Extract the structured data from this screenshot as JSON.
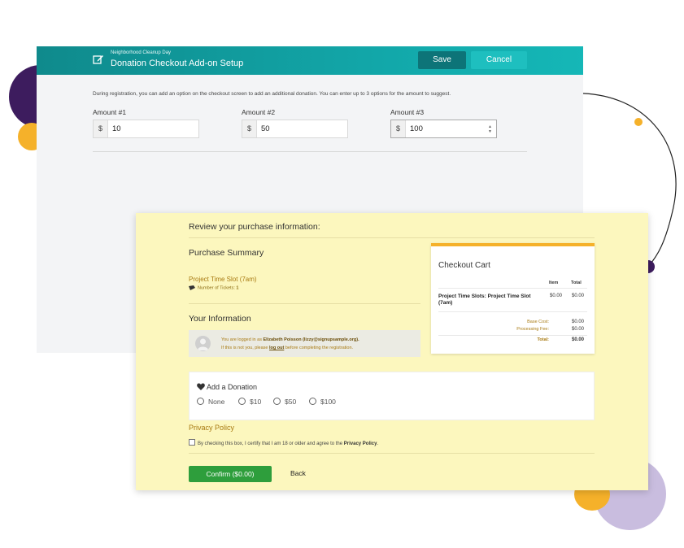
{
  "setup": {
    "subtitle": "Neighborhood Cleanup Day",
    "title": "Donation Checkout Add-on Setup",
    "save_label": "Save",
    "cancel_label": "Cancel",
    "info": "During registration, you can add an option on the checkout screen to add an additional donation. You can enter up to 3 options for the amount to suggest.",
    "currency": "$",
    "amounts": [
      {
        "label": "Amount #1",
        "value": "10"
      },
      {
        "label": "Amount #2",
        "value": "50"
      },
      {
        "label": "Amount #3",
        "value": "100"
      }
    ]
  },
  "review": {
    "title": "Review your purchase information:",
    "summary_title": "Purchase Summary",
    "project": "Project Time Slot (7am)",
    "tickets_label": "Number of Tickets:",
    "tickets_value": "1",
    "info_title": "Your Information",
    "logged_prefix": "You are logged in as",
    "user_name": "Elizabeth Poisson (lizzy@signupsample.org).",
    "not_you_prefix": "If this is not you, please",
    "logout_label": "log out",
    "not_you_suffix": "before completing the registration.",
    "cart": {
      "title": "Checkout Cart",
      "col_item": "Item",
      "col_total": "Total",
      "row_name": "Project Time Slots: Project Time Slot (7am)",
      "row_item": "$0.00",
      "row_total": "$0.00",
      "base_cost_label": "Base Cost:",
      "base_cost": "$0.00",
      "fee_label": "Processing Fee:",
      "fee": "$0.00",
      "total_label": "Total:",
      "total": "$0.00"
    },
    "donation": {
      "title": "Add a Donation",
      "options": [
        "None",
        "$10",
        "$50",
        "$100"
      ]
    },
    "privacy_title": "Privacy Policy",
    "agree_prefix": "By checking this box, I certify that I am 18 or older and agree to the",
    "agree_link": "Privacy Policy",
    "confirm_label": "Confirm ($0.00)",
    "back_label": "Back"
  },
  "colors": {
    "header_teal": "#12a6a8",
    "save_btn": "#0d7478",
    "review_bg": "#fcf7be",
    "accent_gold": "#a87a12",
    "confirm_green": "#2e9e3c",
    "deco_purple": "#3d1c5e",
    "deco_yellow": "#f5b12a",
    "deco_lavender": "#c9bddf"
  }
}
